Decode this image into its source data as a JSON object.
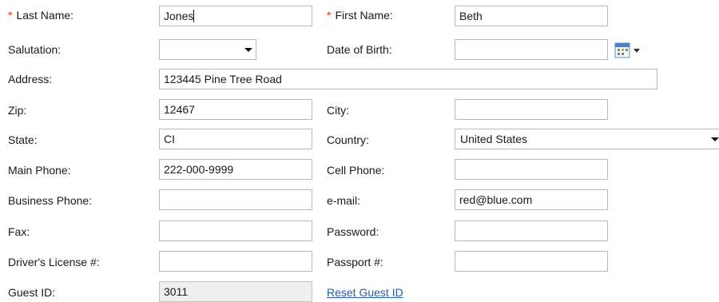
{
  "form": {
    "last_name": {
      "label": "Last Name:",
      "value": "Jones"
    },
    "first_name": {
      "label": "First Name:",
      "value": "Beth"
    },
    "salutation": {
      "label": "Salutation:",
      "value": ""
    },
    "dob": {
      "label": "Date of Birth:",
      "value": ""
    },
    "address": {
      "label": "Address:",
      "value": "123445 Pine Tree Road"
    },
    "zip": {
      "label": "Zip:",
      "value": "12467"
    },
    "city": {
      "label": "City:",
      "value": ""
    },
    "state": {
      "label": "State:",
      "value": "CI"
    },
    "country": {
      "label": "Country:",
      "value": "United States"
    },
    "main_phone": {
      "label": "Main Phone:",
      "value": "222-000-9999"
    },
    "cell_phone": {
      "label": "Cell Phone:",
      "value": ""
    },
    "business_phone": {
      "label": "Business Phone:",
      "value": ""
    },
    "email": {
      "label": "e-mail:",
      "value": "red@blue.com"
    },
    "fax": {
      "label": "Fax:",
      "value": ""
    },
    "password": {
      "label": "Password:",
      "value": ""
    },
    "drivers_license": {
      "label": "Driver's License #:",
      "value": ""
    },
    "passport": {
      "label": "Passport #:",
      "value": ""
    },
    "guest_id": {
      "label": "Guest ID:",
      "value": "3011"
    },
    "reset_guest_id": "Reset Guest ID",
    "required_mark": "*"
  },
  "icons": {
    "calendar": "calendar-icon",
    "dropdown": "chevron-down-icon"
  },
  "colors": {
    "required": "#e8320f",
    "link": "#2d5aa5",
    "readonly_bg": "#efefef"
  }
}
